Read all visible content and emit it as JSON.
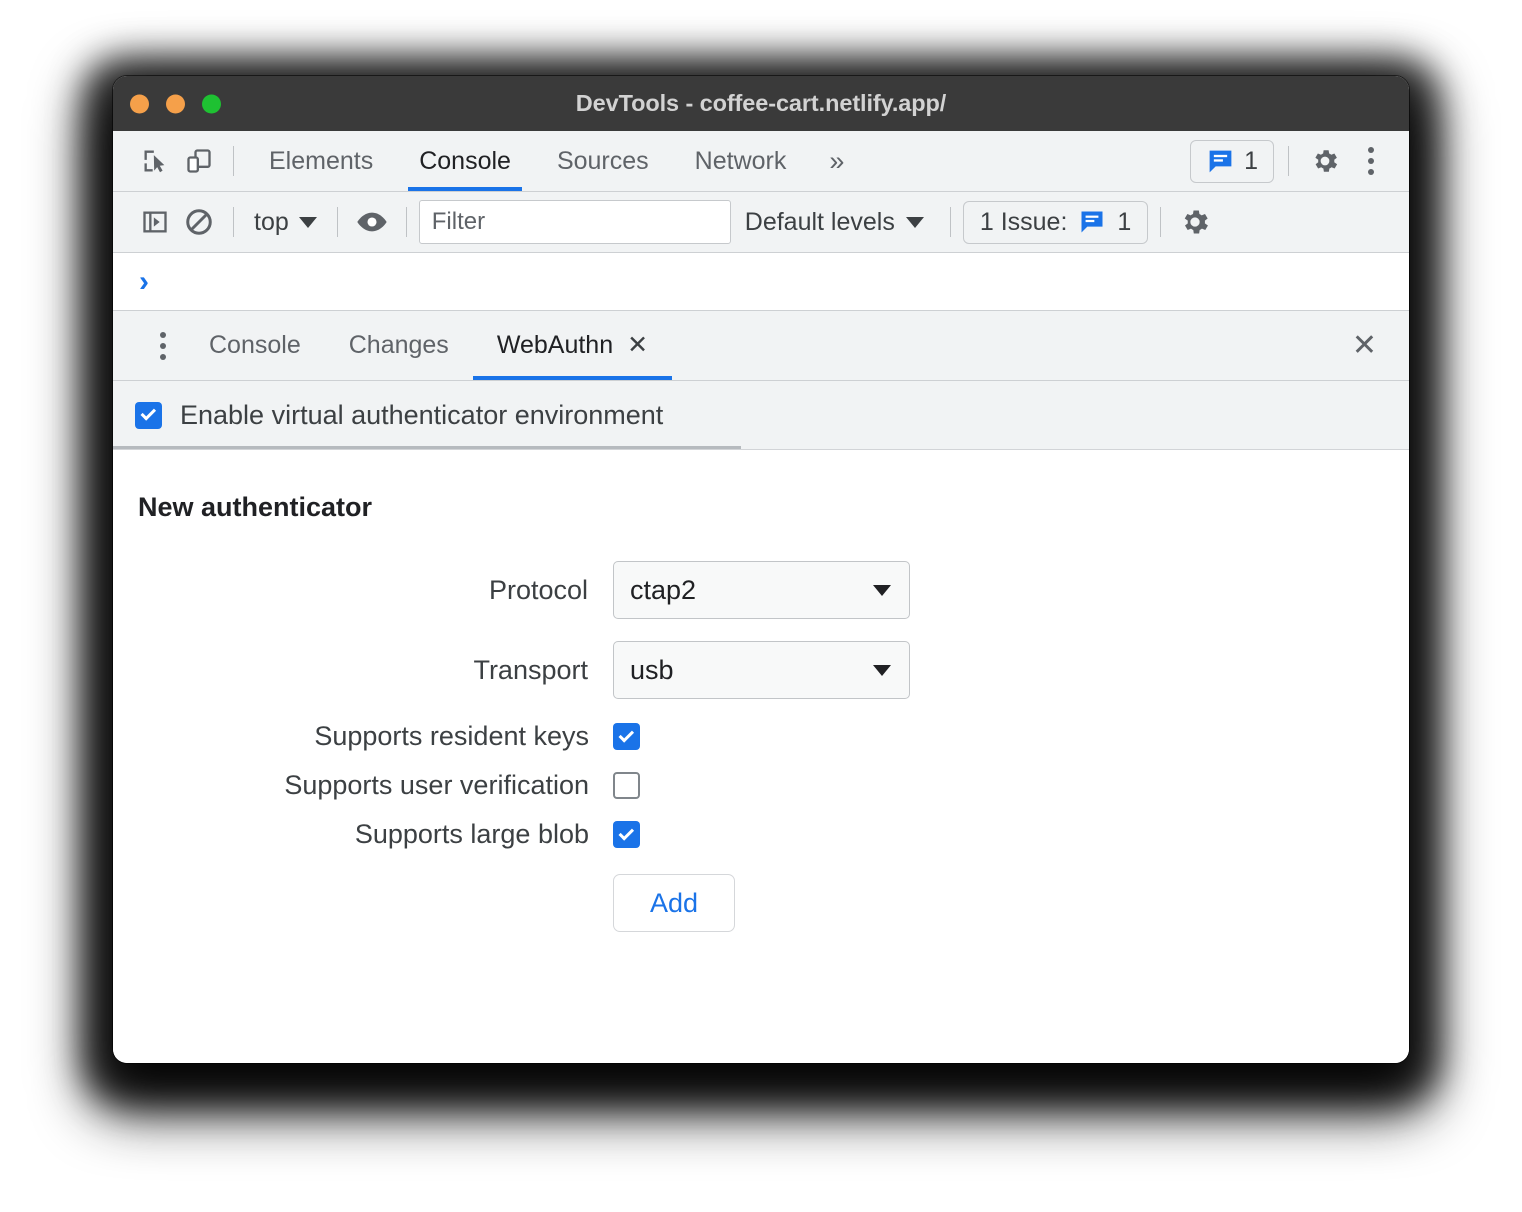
{
  "window": {
    "title": "DevTools - coffee-cart.netlify.app/",
    "traffic_lights": [
      "close",
      "minimize",
      "maximize"
    ]
  },
  "main_toolbar": {
    "inspect_icon": "inspect-element-icon",
    "device_icon": "device-toolbar-icon",
    "tabs": [
      {
        "label": "Elements",
        "active": false
      },
      {
        "label": "Console",
        "active": true
      },
      {
        "label": "Sources",
        "active": false
      },
      {
        "label": "Network",
        "active": false
      }
    ],
    "more_tabs": "»",
    "issues_badge": {
      "icon": "issues-message-icon",
      "count": "1"
    },
    "settings_icon": "gear-icon",
    "menu_icon": "more-vertical-icon"
  },
  "console_toolbar": {
    "sidebar_toggle_icon": "console-sidebar-icon",
    "clear_icon": "clear-console-icon",
    "context": "top",
    "eye_icon": "live-expression-eye-icon",
    "filter_placeholder": "Filter",
    "filter_value": "",
    "levels": "Default levels",
    "issues_button": {
      "text": "1 Issue:",
      "icon": "issues-message-icon",
      "count": "1"
    },
    "settings_icon": "gear-icon"
  },
  "console_prompt": {
    "chevron": "›"
  },
  "drawer": {
    "menu_icon": "more-vertical-icon",
    "tabs": [
      {
        "label": "Console",
        "active": false,
        "closable": false
      },
      {
        "label": "Changes",
        "active": false,
        "closable": false
      },
      {
        "label": "WebAuthn",
        "active": true,
        "closable": true,
        "close_glyph": "✕"
      }
    ],
    "close_glyph": "✕"
  },
  "webauthn": {
    "enable_label": "Enable virtual authenticator environment",
    "enable_checked": true,
    "section_title": "New authenticator",
    "fields": [
      {
        "label": "Protocol",
        "value": "ctap2"
      },
      {
        "label": "Transport",
        "value": "usb"
      }
    ],
    "options": [
      {
        "label": "Supports resident keys",
        "checked": true
      },
      {
        "label": "Supports user verification",
        "checked": false
      },
      {
        "label": "Supports large blob",
        "checked": true
      }
    ],
    "add_label": "Add"
  },
  "colors": {
    "accent": "#1a73e8",
    "toolbar_bg": "#f1f3f4",
    "titlebar_bg": "#3a3a3a",
    "text": "#3c4043"
  }
}
